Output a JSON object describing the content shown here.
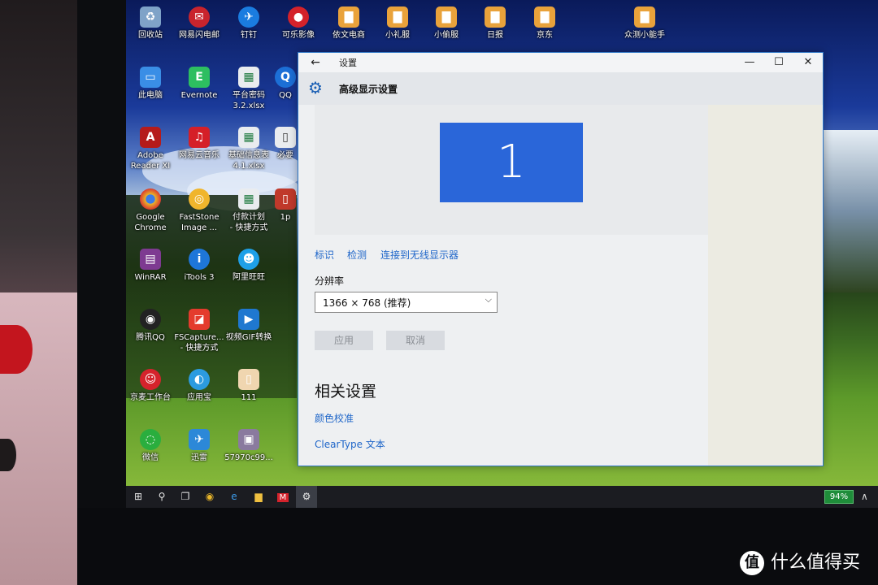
{
  "desktop_icons": {
    "recycle_bin": "回收站",
    "wangyi_mail": "网易闪电邮",
    "dingding": "钉钉",
    "kele_video": "可乐影像",
    "yiwen": "依文电商",
    "xiaoli": "小礼服",
    "xiaotou": "小偷服",
    "riji": "日报",
    "jingdong": "京东",
    "zhongce": "众测小能手",
    "this_pc": "此电脑",
    "evernote": "Evernote",
    "pingtai": "平台密码\n3.2.xlsx",
    "qq_partial": "QQ",
    "adobe": "Adobe\nReader XI",
    "netease_music": "网易云音乐",
    "jichu": "基础信息表\n4.1.xlsx",
    "bibei": "必要",
    "chrome": "Google\nChrome",
    "faststone": "FastStone\nImage ...",
    "fukuan": "付款计划\n- 快捷方式",
    "one_partial": "1p",
    "winrar": "WinRAR",
    "itools": "iTools 3",
    "aliwangwang": "阿里旺旺",
    "tencent_qq": "腾讯QQ",
    "fscapture": "FSCapture...\n- 快捷方式",
    "gif": "视频GIF转换",
    "jingmai": "京麦工作台",
    "yingyongbao": "应用宝",
    "one_one_one": "111",
    "wechat": "微信",
    "xunlei": "迅雷",
    "image_file": "57970c99..."
  },
  "window": {
    "title": "设置",
    "page_title": "高级显示设置",
    "monitor_number": "1",
    "links": {
      "identify": "标识",
      "detect": "检测",
      "wireless": "连接到无线显示器"
    },
    "resolution_label": "分辨率",
    "resolution_value": "1366 × 768 (推荐)",
    "apply": "应用",
    "cancel": "取消",
    "related_title": "相关设置",
    "color_calibration": "颜色校准",
    "cleartype": "ClearType 文本",
    "minimize": "—",
    "maximize": "☐",
    "close": "✕",
    "back": "←"
  },
  "taskbar": {
    "battery": "94%"
  },
  "watermark": {
    "badge": "值",
    "text": "什么值得买"
  },
  "icons": {
    "back": "arrow-left-icon",
    "gear": "gear-icon",
    "dropdown": "chevron-down-icon"
  },
  "colors": {
    "accent": "#1f66c9",
    "monitor": "#2a66d9",
    "battery": "#1f8d3a"
  }
}
